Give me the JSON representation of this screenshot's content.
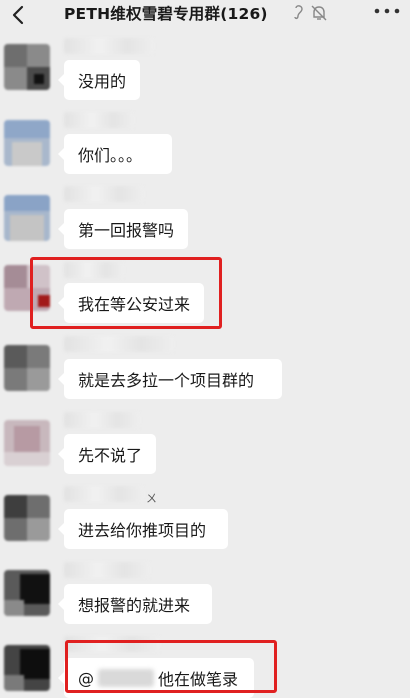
{
  "header": {
    "title": "PETH维权雪碧专用群(126)",
    "back_icon": "chevron-left-icon",
    "mute_icon": "bell-off-icon",
    "ear_icon": "ear-icon",
    "more_icon": "more-dots-icon"
  },
  "messages": [
    {
      "text": "没用的"
    },
    {
      "text": "你们。。。"
    },
    {
      "text": "第一回报警吗"
    },
    {
      "text": "我在等公安过来",
      "highlighted": true
    },
    {
      "text": "就是去多拉一个项目群的"
    },
    {
      "text": "先不说了"
    },
    {
      "text": "进去给你推项目的"
    },
    {
      "text": "想报警的就进来"
    },
    {
      "prefix": "@",
      "text": "他在做笔录",
      "highlighted": true
    }
  ],
  "stray_glyph": "ㄨ",
  "colors": {
    "background": "#ededed",
    "bubble": "#ffffff",
    "highlight_box": "#e02020",
    "text": "#191919"
  }
}
